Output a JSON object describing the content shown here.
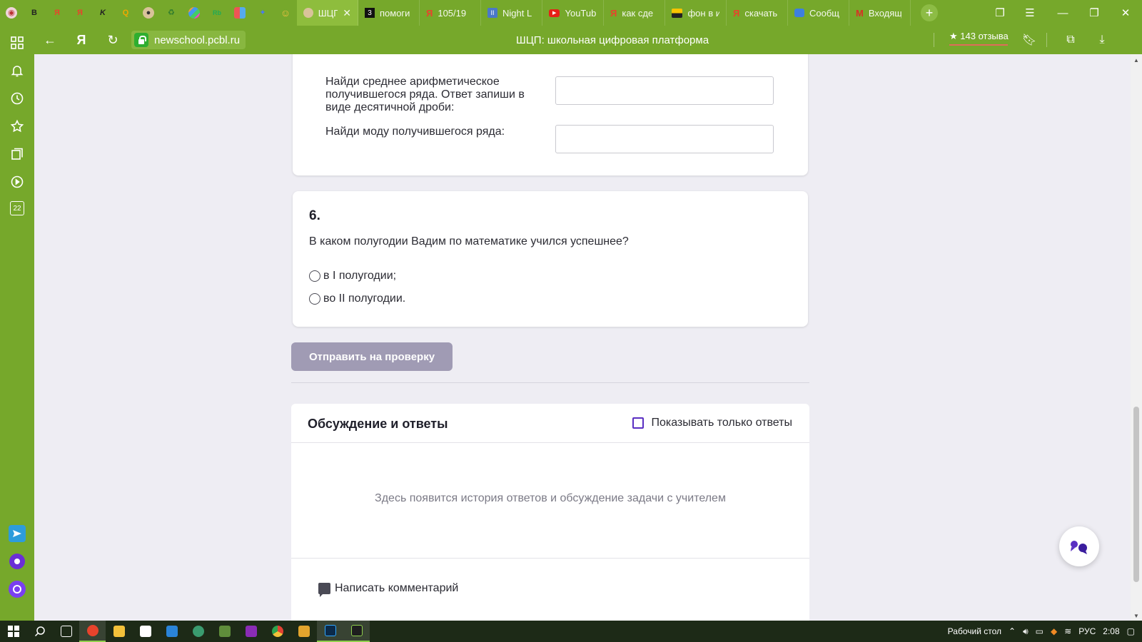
{
  "browser": {
    "tabs": [
      {
        "icon": "yandex-avatar-icon",
        "label": ""
      },
      {
        "icon": "bold-b-icon",
        "label": ""
      },
      {
        "icon": "yandex-icon",
        "label": ""
      },
      {
        "icon": "yandex-icon",
        "label": ""
      },
      {
        "icon": "k-logo-icon",
        "label": ""
      },
      {
        "icon": "q-logo-icon",
        "label": ""
      },
      {
        "icon": "owl-icon",
        "label": ""
      },
      {
        "icon": "recycle-icon",
        "label": ""
      },
      {
        "icon": "pinwheel-icon",
        "label": ""
      },
      {
        "icon": "rb-icon",
        "label": ""
      },
      {
        "icon": "puzzle-icon",
        "label": ""
      },
      {
        "icon": "sparkle-icon",
        "label": ""
      },
      {
        "icon": "smiley-icon",
        "label": ""
      }
    ],
    "named_tabs": [
      {
        "label": "ШЦП",
        "icon": "owl-icon",
        "active": true
      },
      {
        "label": "помоги",
        "icon": "z-icon",
        "active": false
      },
      {
        "label": "105/19",
        "icon": "yandex-icon",
        "active": false
      },
      {
        "label": "Night L",
        "icon": "pause-icon",
        "active": false
      },
      {
        "label": "YouTub",
        "icon": "youtube-icon",
        "active": false
      },
      {
        "label": "как сде",
        "icon": "yandex-icon",
        "active": false
      },
      {
        "label": "фон в и",
        "icon": "image-icon",
        "active": false
      },
      {
        "label": "скачать",
        "icon": "yandex-icon",
        "active": false
      },
      {
        "label": "Сообщ",
        "icon": "chat-icon",
        "active": false
      },
      {
        "label": "Входящ",
        "icon": "gmail-icon",
        "active": false
      }
    ],
    "url": "newschool.pcbl.ru",
    "page_title": "ШЦП: школьная цифровая платформа",
    "reviews": "★ 143 отзыва"
  },
  "task5": {
    "label_mean": "Найди среднее арифметическое получившегося ряда. Ответ запиши в виде десятичной дроби:",
    "label_mode": "Найди моду получившегося ряда:",
    "mean_value": "",
    "mode_value": ""
  },
  "task6": {
    "number": "6.",
    "question": "В каком полугодии Вадим по математике учился успешнее?",
    "options": [
      "в I полугодии;",
      "во II полугодии."
    ]
  },
  "submit_label": "Отправить на проверку",
  "discussion": {
    "title": "Обсуждение и ответы",
    "only_answers_label": "Показывать только ответы",
    "empty_text": "Здесь появится история ответов и обсуждение задачи с учителем",
    "write_comment": "Написать комментарий"
  },
  "taskbar": {
    "desktop_label": "Рабочий стол",
    "lang": "РУС",
    "time": "2:08"
  },
  "sidebar_badge": "22",
  "colors": {
    "browser_green": "#76a82b",
    "submit_disabled": "#a09bb4",
    "checkbox_purple": "#5a2fc2"
  }
}
